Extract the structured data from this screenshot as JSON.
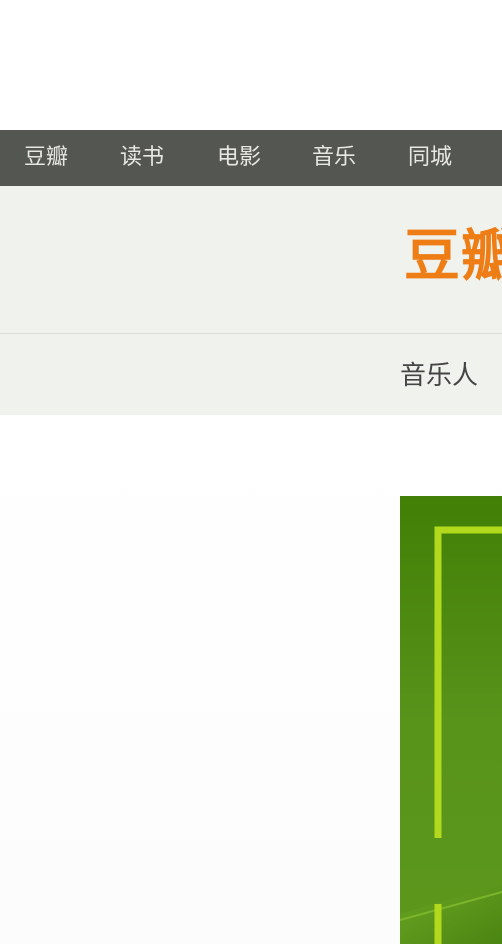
{
  "nav": {
    "items": [
      {
        "label": "豆瓣"
      },
      {
        "label": "读书"
      },
      {
        "label": "电影"
      },
      {
        "label": "音乐"
      },
      {
        "label": "同城"
      }
    ]
  },
  "header": {
    "logo_text": "豆瓣"
  },
  "subnav": {
    "items": [
      {
        "label": "音乐人"
      }
    ]
  },
  "banner": {
    "icon": "promo-banner-image"
  },
  "colors": {
    "nav_bg": "#545652",
    "nav_text": "#e8e8e3",
    "header_bg": "#f0f2ee",
    "logo": "#ee7d15",
    "banner_green": "#4e8a12",
    "banner_accent": "#b4dc1e"
  }
}
